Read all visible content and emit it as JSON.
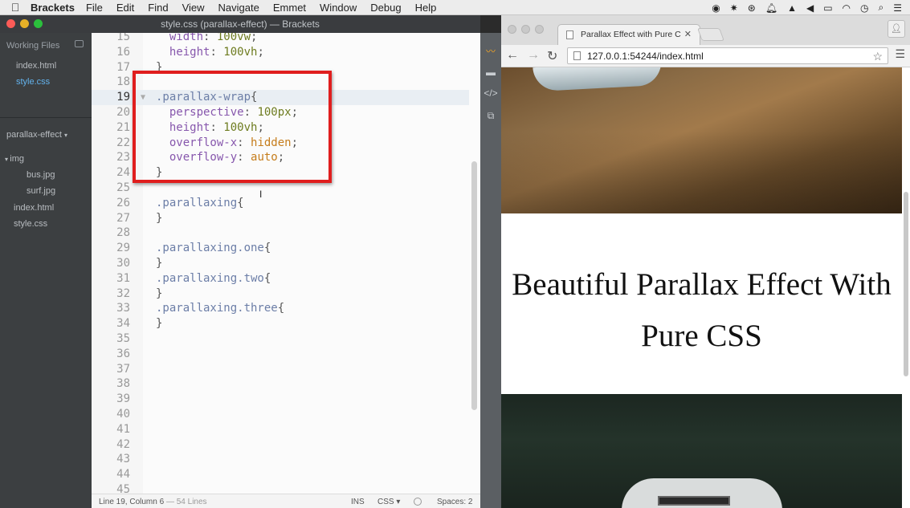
{
  "menubar": {
    "app": "Brackets",
    "items": [
      "File",
      "Edit",
      "Find",
      "View",
      "Navigate",
      "Emmet",
      "Window",
      "Debug",
      "Help"
    ]
  },
  "brackets": {
    "window_title": "style.css (parallax-effect) — Brackets",
    "sidebar": {
      "working_files_label": "Working Files",
      "working_files": [
        "index.html",
        "style.css"
      ],
      "project": "parallax-effect",
      "tree": [
        {
          "name": "img",
          "depth": 0,
          "folder": true
        },
        {
          "name": "bus.jpg",
          "depth": 1,
          "folder": false
        },
        {
          "name": "surf.jpg",
          "depth": 1,
          "folder": false
        },
        {
          "name": "index.html",
          "depth": 0,
          "folder": false
        },
        {
          "name": "style.css",
          "depth": 0,
          "folder": false
        }
      ]
    },
    "editor": {
      "lines": [
        {
          "n": "15",
          "text": "  width: 100vw;"
        },
        {
          "n": "16",
          "text": "  height: 100vh;"
        },
        {
          "n": "17",
          "text": "}"
        },
        {
          "n": "18",
          "text": ""
        },
        {
          "n": "19",
          "text": ".parallax-wrap{",
          "active": true
        },
        {
          "n": "20",
          "text": "  perspective: 100px;"
        },
        {
          "n": "21",
          "text": "  height: 100vh;"
        },
        {
          "n": "22",
          "text": "  overflow-x: hidden;"
        },
        {
          "n": "23",
          "text": "  overflow-y: auto;"
        },
        {
          "n": "24",
          "text": "}"
        },
        {
          "n": "25",
          "text": ""
        },
        {
          "n": "26",
          "text": ".parallaxing{"
        },
        {
          "n": "27",
          "text": "}"
        },
        {
          "n": "28",
          "text": ""
        },
        {
          "n": "29",
          "text": ".parallaxing.one{"
        },
        {
          "n": "30",
          "text": "}"
        },
        {
          "n": "31",
          "text": ".parallaxing.two{"
        },
        {
          "n": "32",
          "text": "}"
        },
        {
          "n": "33",
          "text": ".parallaxing.three{"
        },
        {
          "n": "34",
          "text": "}"
        },
        {
          "n": "35",
          "text": ""
        },
        {
          "n": "36",
          "text": ""
        },
        {
          "n": "37",
          "text": ""
        },
        {
          "n": "38",
          "text": ""
        },
        {
          "n": "39",
          "text": ""
        },
        {
          "n": "40",
          "text": ""
        },
        {
          "n": "41",
          "text": ""
        },
        {
          "n": "42",
          "text": ""
        },
        {
          "n": "43",
          "text": ""
        },
        {
          "n": "44",
          "text": ""
        },
        {
          "n": "45",
          "text": ""
        }
      ]
    },
    "status": {
      "position": "Line 19, Column 6",
      "lines": "— 54 Lines",
      "mode": "INS",
      "language": "CSS ▾",
      "spaces": "Spaces: 2"
    }
  },
  "chrome": {
    "tab_title": "Parallax Effect with Pure C",
    "url": "127.0.0.1:54244/index.html",
    "heading": "Beautiful Parallax Effect With Pure CSS"
  },
  "colors": {
    "highlight_box": "#e01e1e",
    "active_file": "#63b3ed",
    "selector": "#6c7ea7",
    "property": "#8757ad",
    "value": "#6e7c20",
    "keyword": "#c67d1c"
  }
}
